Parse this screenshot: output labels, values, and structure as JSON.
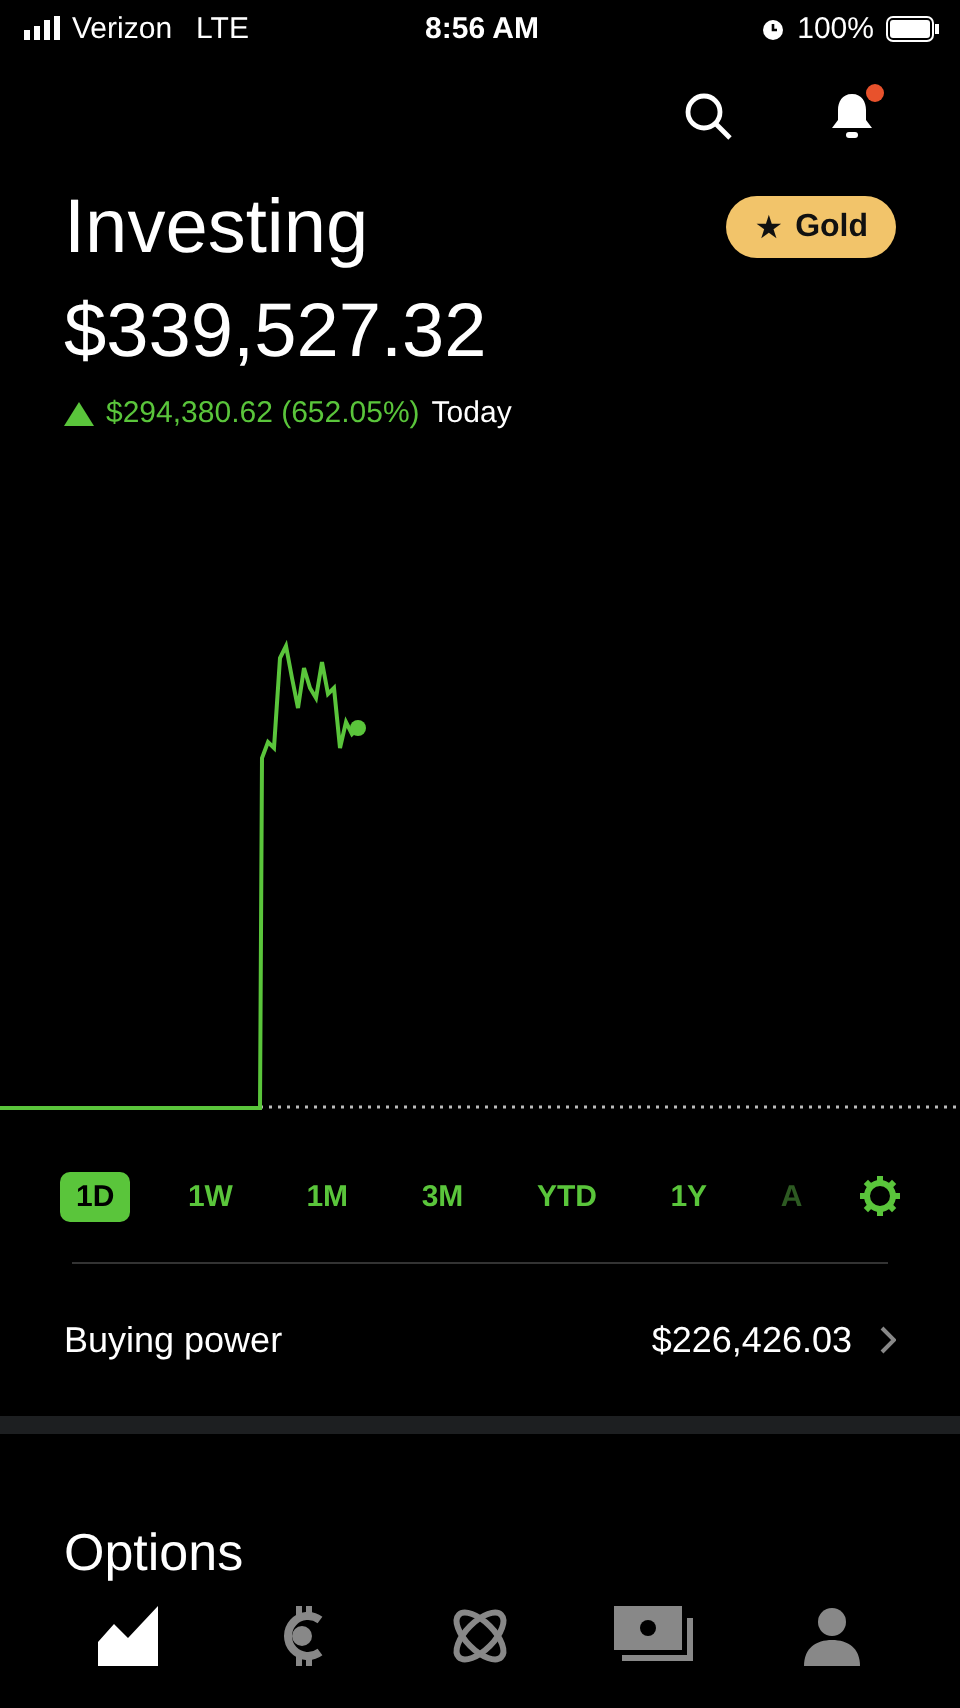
{
  "status_bar": {
    "carrier": "Verizon",
    "network": "LTE",
    "time": "8:56 AM",
    "battery": "100%"
  },
  "header": {
    "notification_unread": true,
    "badge": "Gold",
    "badge_icon": "★"
  },
  "title": "Investing",
  "portfolio_value": "$339,527.32",
  "change": {
    "up": true,
    "amount": "$294,380.62 (652.05%)",
    "period": "Today"
  },
  "ranges": [
    {
      "label": "1D",
      "selected": true,
      "faded": false
    },
    {
      "label": "1W",
      "selected": false,
      "faded": false
    },
    {
      "label": "1M",
      "selected": false,
      "faded": false
    },
    {
      "label": "3M",
      "selected": false,
      "faded": false
    },
    {
      "label": "YTD",
      "selected": false,
      "faded": false
    },
    {
      "label": "1Y",
      "selected": false,
      "faded": false
    },
    {
      "label": "A",
      "selected": false,
      "faded": true
    }
  ],
  "buying_power": {
    "label": "Buying power",
    "value": "$226,426.03"
  },
  "section_title": "Options",
  "nav_tabs": [
    {
      "kind": "chart",
      "selected": true
    },
    {
      "kind": "coin",
      "selected": false
    },
    {
      "kind": "orbit",
      "selected": false
    },
    {
      "kind": "cash",
      "selected": false
    },
    {
      "kind": "person",
      "selected": false
    }
  ]
}
